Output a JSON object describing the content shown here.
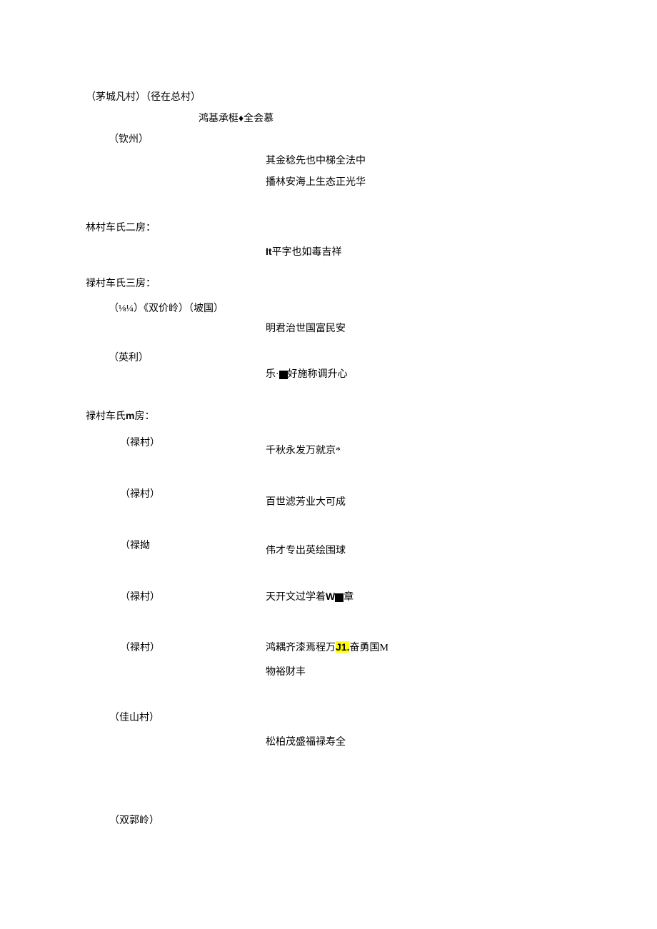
{
  "lines": {
    "l1": "（茅城凡村）（径在总村）",
    "l2": "鸿基承梃♦全会慕",
    "l3": "（钦州）",
    "l4": "其金稔先也中梯全法中",
    "l5": "播林安海上生态正光华",
    "l6": "林村车氏二房：",
    "l7a": "It",
    "l7b": "平字也如毒吉祥",
    "l8": "禄村车氏三房：",
    "l9": "（⅛¼）《双价岭）（坡国）",
    "l10": "明君治世国富民安",
    "l11": "（英利）",
    "l12a": "乐·",
    "l12b": "好施称调升心",
    "l13a": "禄村车氏",
    "l13b": "m",
    "l13c": "房：",
    "l14": "（禄村）",
    "l15": "千秋永发万就京*",
    "l16": "（禄村）",
    "l17": "百世滤芳业大可成",
    "l18": "（禄拗",
    "l19": "伟才专出英绘围球",
    "l20": "（禄村）",
    "l21a": "天开文过学着",
    "l21b": "W",
    "l21c": "章",
    "l22": "（禄村）",
    "l23a": "鸿耦齐漆焉程万",
    "l23b": "J1.",
    "l23c": "奋勇国M",
    "l24": "物裕财丰",
    "l25": "（佳山村）",
    "l26": "松柏茂盛福禄寿全",
    "l27": "（双郭岭）"
  }
}
